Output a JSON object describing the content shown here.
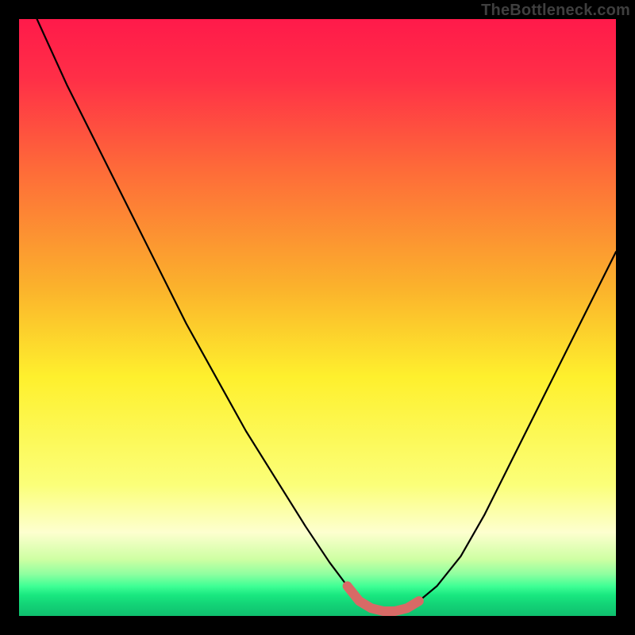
{
  "attribution": "TheBottleneck.com",
  "colors": {
    "frame": "#000000",
    "attribution_text": "#3f3f3f",
    "curve": "#000000",
    "highlight": "#d86a66",
    "gradient_stops": [
      {
        "offset": 0.0,
        "color": "#ff1a4a"
      },
      {
        "offset": 0.1,
        "color": "#ff2f47"
      },
      {
        "offset": 0.25,
        "color": "#fe6a39"
      },
      {
        "offset": 0.45,
        "color": "#fbb22c"
      },
      {
        "offset": 0.6,
        "color": "#fef02d"
      },
      {
        "offset": 0.78,
        "color": "#fbff79"
      },
      {
        "offset": 0.86,
        "color": "#fdffcf"
      },
      {
        "offset": 0.905,
        "color": "#ceffa3"
      },
      {
        "offset": 0.93,
        "color": "#8effa0"
      },
      {
        "offset": 0.95,
        "color": "#3fff95"
      },
      {
        "offset": 0.965,
        "color": "#19e880"
      },
      {
        "offset": 0.98,
        "color": "#13d477"
      },
      {
        "offset": 1.0,
        "color": "#0fbf6e"
      }
    ]
  },
  "chart_data": {
    "type": "line",
    "title": "",
    "xlabel": "",
    "ylabel": "",
    "xlim": [
      0,
      100
    ],
    "ylim": [
      0,
      100
    ],
    "grid": false,
    "legend": false,
    "series": [
      {
        "name": "bottleneck-curve",
        "x": [
          0,
          3,
          8,
          13,
          18,
          23,
          28,
          33,
          38,
          43,
          48,
          52,
          55,
          57,
          59,
          61,
          63,
          65,
          67,
          70,
          74,
          78,
          82,
          86,
          90,
          94,
          98,
          100
        ],
        "y": [
          108,
          100,
          89,
          79,
          69,
          59,
          49,
          40,
          31,
          23,
          15,
          9,
          5,
          2.5,
          1.3,
          0.8,
          0.8,
          1.3,
          2.5,
          5,
          10,
          17,
          25,
          33,
          41,
          49,
          57,
          61
        ]
      }
    ],
    "highlight_range_x": [
      55,
      67
    ],
    "annotations": []
  }
}
